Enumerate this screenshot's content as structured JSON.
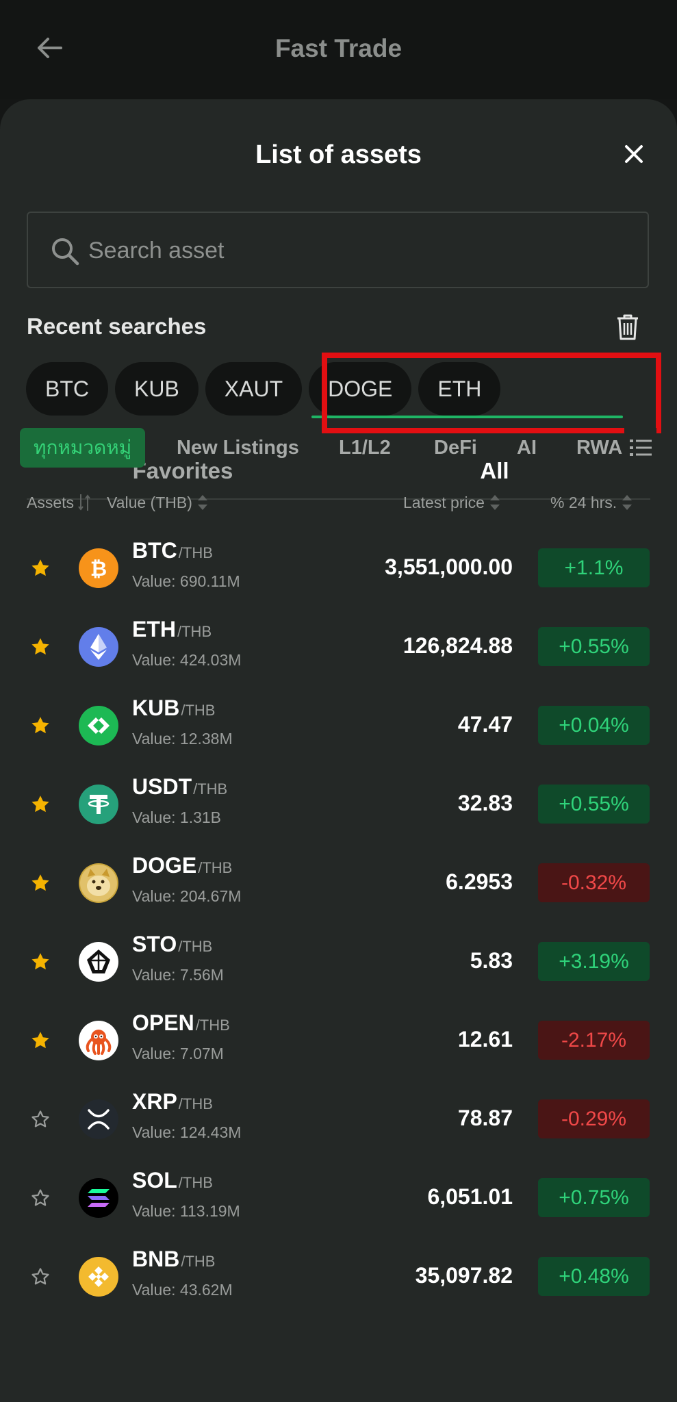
{
  "header": {
    "title": "Fast Trade"
  },
  "sheet": {
    "title": "List of assets",
    "search_placeholder": "Search asset",
    "recent_label": "Recent searches",
    "recent": [
      "BTC",
      "KUB",
      "XAUT",
      "DOGE",
      "ETH"
    ]
  },
  "tabs": {
    "favorites": "Favorites",
    "all": "All",
    "active": "All"
  },
  "categories": [
    "ทุกหมวดหมู่",
    "New Listings",
    "L1/L2",
    "DeFi",
    "AI",
    "RWA"
  ],
  "columns": {
    "assets": "Assets",
    "value": "Value (THB)",
    "price": "Latest price",
    "change": "% 24 hrs."
  },
  "colors": {
    "accent": "#1fb565",
    "up": "#2fd37a",
    "down": "#f04848",
    "star": "#f5b301",
    "highlight": "#e20f12"
  },
  "assets": [
    {
      "symbol": "BTC",
      "quote": "/THB",
      "value": "Value: 690.11M",
      "price": "3,551,000.00",
      "change": "+1.1%",
      "dir": "up",
      "favorite": true,
      "icon": "btc-icon",
      "color": "#f7931a"
    },
    {
      "symbol": "ETH",
      "quote": "/THB",
      "value": "Value: 424.03M",
      "price": "126,824.88",
      "change": "+0.55%",
      "dir": "up",
      "favorite": true,
      "icon": "eth-icon",
      "color": "#627eea"
    },
    {
      "symbol": "KUB",
      "quote": "/THB",
      "value": "Value: 12.38M",
      "price": "47.47",
      "change": "+0.04%",
      "dir": "up",
      "favorite": true,
      "icon": "kub-icon",
      "color": "#1db954"
    },
    {
      "symbol": "USDT",
      "quote": "/THB",
      "value": "Value: 1.31B",
      "price": "32.83",
      "change": "+0.55%",
      "dir": "up",
      "favorite": true,
      "icon": "usdt-icon",
      "color": "#26a17b"
    },
    {
      "symbol": "DOGE",
      "quote": "/THB",
      "value": "Value: 204.67M",
      "price": "6.2953",
      "change": "-0.32%",
      "dir": "down",
      "favorite": true,
      "icon": "doge-icon",
      "color": "#c9a53a"
    },
    {
      "symbol": "STO",
      "quote": "/THB",
      "value": "Value: 7.56M",
      "price": "5.83",
      "change": "+3.19%",
      "dir": "up",
      "favorite": true,
      "icon": "sto-icon",
      "color": "#ffffff"
    },
    {
      "symbol": "OPEN",
      "quote": "/THB",
      "value": "Value: 7.07M",
      "price": "12.61",
      "change": "-2.17%",
      "dir": "down",
      "favorite": true,
      "icon": "open-icon",
      "color": "#ffffff"
    },
    {
      "symbol": "XRP",
      "quote": "/THB",
      "value": "Value: 124.43M",
      "price": "78.87",
      "change": "-0.29%",
      "dir": "down",
      "favorite": false,
      "icon": "xrp-icon",
      "color": "#23292f"
    },
    {
      "symbol": "SOL",
      "quote": "/THB",
      "value": "Value: 113.19M",
      "price": "6,051.01",
      "change": "+0.75%",
      "dir": "up",
      "favorite": false,
      "icon": "sol-icon",
      "color": "#000000"
    },
    {
      "symbol": "BNB",
      "quote": "/THB",
      "value": "Value: 43.62M",
      "price": "35,097.82",
      "change": "+0.48%",
      "dir": "up",
      "favorite": false,
      "icon": "bnb-icon",
      "color": "#f3ba2f"
    }
  ]
}
